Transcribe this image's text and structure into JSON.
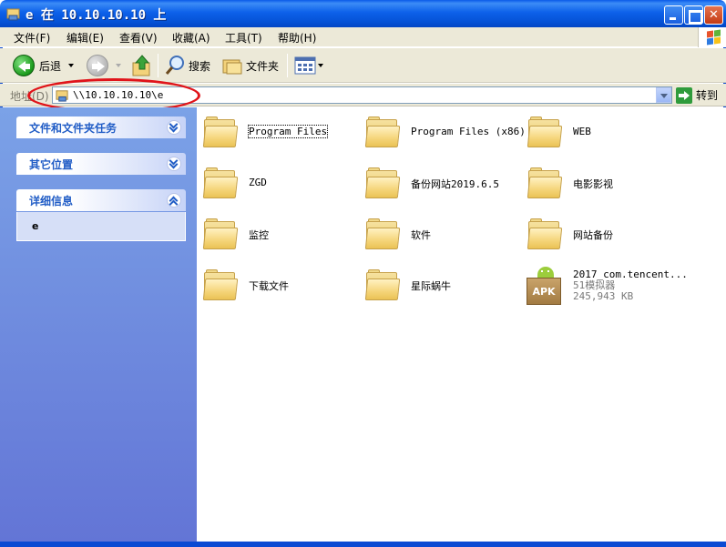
{
  "window": {
    "title": "e 在 10.10.10.10 上",
    "icon": "network-folder-icon"
  },
  "menu": [
    "文件(F)",
    "编辑(E)",
    "查看(V)",
    "收藏(A)",
    "工具(T)",
    "帮助(H)"
  ],
  "toolbar": {
    "back_label": "后退",
    "search_label": "搜索",
    "folders_label": "文件夹"
  },
  "address": {
    "label": "地址(D)",
    "value": "\\\\10.10.10.10\\e",
    "go_label": "转到"
  },
  "left_panels": [
    {
      "title": "文件和文件夹任务",
      "state": "collapsed"
    },
    {
      "title": "其它位置",
      "state": "collapsed"
    },
    {
      "title": "详细信息",
      "state": "expanded",
      "body": "e"
    }
  ],
  "items": [
    {
      "name": "Program Files",
      "type": "folder"
    },
    {
      "name": "Program Files (x86)",
      "type": "folder"
    },
    {
      "name": "WEB",
      "type": "folder"
    },
    {
      "name": "ZGD",
      "type": "folder"
    },
    {
      "name": "备份网站2019.6.5",
      "type": "folder"
    },
    {
      "name": "电影影视",
      "type": "folder"
    },
    {
      "name": "监控",
      "type": "folder"
    },
    {
      "name": "软件",
      "type": "folder"
    },
    {
      "name": "网站备份",
      "type": "folder"
    },
    {
      "name": "下载文件",
      "type": "folder"
    },
    {
      "name": "星际蜗牛",
      "type": "folder"
    },
    {
      "name": "2017_com.tencent...",
      "type": "apk",
      "desc": "51模拟器",
      "size": "245,943 KB"
    }
  ],
  "colors": {
    "titlebar": "#0a5ae8",
    "leftpane": "#6f8ee0",
    "highlight_ellipse": "#e0141a"
  }
}
